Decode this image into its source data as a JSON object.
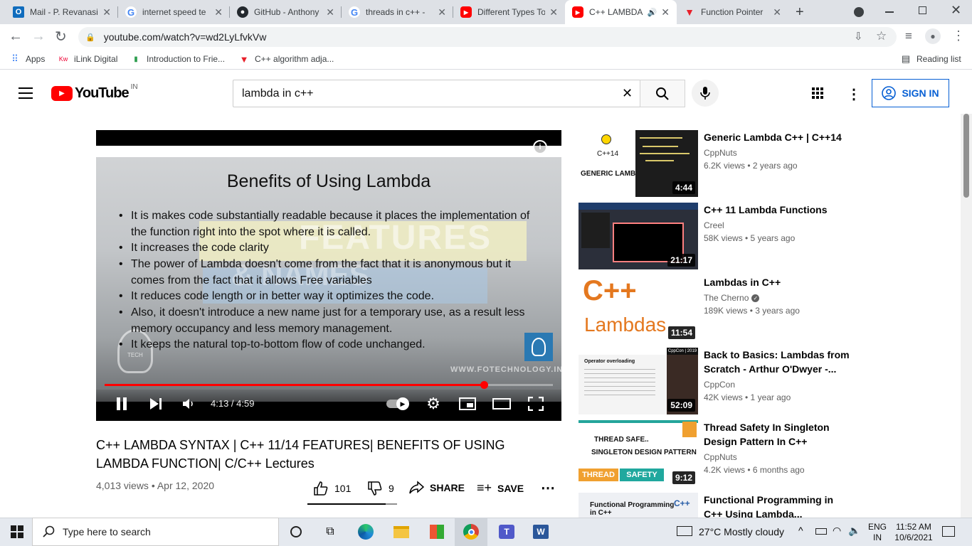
{
  "browser": {
    "tabs": [
      {
        "title": "Mail - P. Revanasi",
        "icon": "outlook-icon",
        "color": "#0f6cbd",
        "active": false
      },
      {
        "title": "internet speed te",
        "icon": "google-icon",
        "color": "#4285f4",
        "active": false
      },
      {
        "title": "GitHub - Anthony",
        "icon": "github-icon",
        "color": "#24292e",
        "active": false
      },
      {
        "title": "threads in c++ -",
        "icon": "google-icon",
        "color": "#4285f4",
        "active": false
      },
      {
        "title": "Different Types To",
        "icon": "youtube-icon",
        "color": "#ff0000",
        "active": false
      },
      {
        "title": "C++ LAMBDA",
        "icon": "youtube-icon",
        "color": "#ff0000",
        "active": true
      },
      {
        "title": "Function Pointer",
        "icon": "vivaldi-icon",
        "color": "#e8202a",
        "active": false
      }
    ],
    "url": "youtube.com/watch?v=wd2LyLfvkVw",
    "bookmarks": [
      {
        "label": "Apps",
        "icon": "apps-grid-icon"
      },
      {
        "label": "iLink Digital",
        "icon": "ilink-icon"
      },
      {
        "label": "Introduction to Frie...",
        "icon": "bookmark-green-icon"
      },
      {
        "label": "C++ algorithm adja...",
        "icon": "vivaldi-icon"
      }
    ],
    "reading_list": "Reading list"
  },
  "youtube": {
    "logo_text": "YouTube",
    "country": "IN",
    "search_value": "lambda in c++",
    "sign_in": "SIGN IN"
  },
  "player": {
    "slide_title": "Benefits of Using Lambda",
    "bullets": [
      "It is makes code substantially readable because it places the implementation of the function right into the spot where it is called.",
      "It increases the code clarity",
      "The power of Lambda doesn't come from the fact that it is anonymous but it comes from the fact that it allows Free variables",
      "It reduces code length or in better way it optimizes the code.",
      "Also, it doesn't introduce a new name just for a temporary use, as a result less memory occupancy and less memory management.",
      "It keeps the natural top-to-bottom flow of code unchanged."
    ],
    "background_text_1": "FEATURES",
    "background_text_2": "& NAMES",
    "watermark": "WWW.FOTECHNOLOGY.IN",
    "logo_caption": "TECH",
    "time": "4:13 / 4:59",
    "progress_fraction": 0.846
  },
  "video": {
    "title": "C++ LAMBDA SYNTAX | C++ 11/14 FEATURES| BENEFITS OF USING LAMBDA FUNCTION| C/C++ Lectures",
    "meta": "4,013 views • Apr 12, 2020",
    "likes": "101",
    "dislikes": "9",
    "share": "SHARE",
    "save": "SAVE"
  },
  "recommendations": [
    {
      "title": "Generic Lambda C++ | C++14",
      "channel": "CppNuts",
      "views": "6.2K views • 2 years ago",
      "duration": "4:44",
      "thumb_a": "C++14",
      "thumb_b": "GENERIC LAMBDA"
    },
    {
      "title": "C++ 11 Lambda Functions",
      "channel": "Creel",
      "views": "58K views • 5 years ago",
      "duration": "21:17"
    },
    {
      "title": "Lambdas in C++",
      "channel": "The Cherno",
      "verified": true,
      "views": "189K views • 3 years ago",
      "duration": "11:54",
      "thumb_a": "C++",
      "thumb_b": "Lambdas"
    },
    {
      "title": "Back to Basics: Lambdas from Scratch - Arthur O'Dwyer -...",
      "channel": "CppCon",
      "views": "42K views • 1 year ago",
      "duration": "52:09",
      "thumb_a": "Operator overloading",
      "thumb_b": "CppCon | 2019"
    },
    {
      "title": "Thread Safety In Singleton Design Pattern In C++",
      "channel": "CppNuts",
      "views": "4.2K views • 6 months ago",
      "duration": "9:12",
      "thumb_a": "THREAD SAFE..",
      "thumb_b": "SINGLETON DESIGN PATTERN",
      "thumb_c": "THREAD",
      "thumb_d": "SAFETY"
    },
    {
      "title": "Functional Programming in C++ Using Lambda...",
      "thumb_a": "Functional Programming in C++",
      "thumb_b": "C++"
    }
  ],
  "taskbar": {
    "search_placeholder": "Type here to search",
    "weather": "27°C  Mostly cloudy",
    "lang_1": "ENG",
    "lang_2": "IN",
    "time": "11:52 AM",
    "date": "10/6/2021"
  }
}
